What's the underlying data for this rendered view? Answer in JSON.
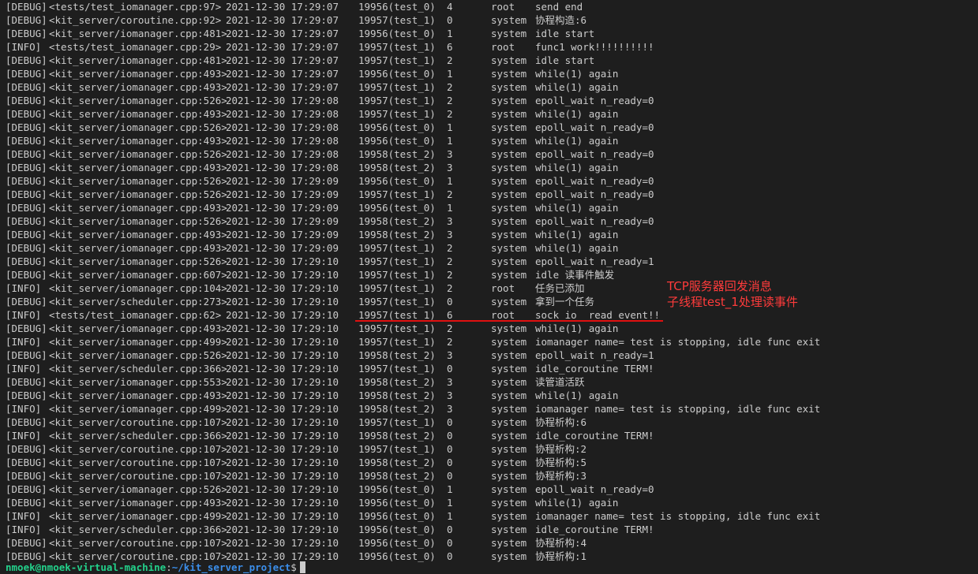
{
  "terminal": {
    "rows": [
      {
        "level": "[DEBUG]",
        "source": "<tests/test_iomanager.cpp:97>",
        "time": "2021-12-30 17:29:07",
        "thread": "19956(test_0)",
        "fiber": "4",
        "logger": "root",
        "message": "send end"
      },
      {
        "level": "[DEBUG]",
        "source": "<kit_server/coroutine.cpp:92>",
        "time": "2021-12-30 17:29:07",
        "thread": "19957(test_1)",
        "fiber": "0",
        "logger": "system",
        "message": "协程构造:6"
      },
      {
        "level": "[DEBUG]",
        "source": "<kit_server/iomanager.cpp:481>",
        "time": "2021-12-30 17:29:07",
        "thread": "19956(test_0)",
        "fiber": "1",
        "logger": "system",
        "message": "idle start"
      },
      {
        "level": "[INFO]",
        "source": "<tests/test_iomanager.cpp:29>",
        "time": "2021-12-30 17:29:07",
        "thread": "19957(test_1)",
        "fiber": "6",
        "logger": "root",
        "message": "func1 work!!!!!!!!!!"
      },
      {
        "level": "[DEBUG]",
        "source": "<kit_server/iomanager.cpp:481>",
        "time": "2021-12-30 17:29:07",
        "thread": "19957(test_1)",
        "fiber": "2",
        "logger": "system",
        "message": "idle start"
      },
      {
        "level": "[DEBUG]",
        "source": "<kit_server/iomanager.cpp:493>",
        "time": "2021-12-30 17:29:07",
        "thread": "19956(test_0)",
        "fiber": "1",
        "logger": "system",
        "message": "while(1) again"
      },
      {
        "level": "[DEBUG]",
        "source": "<kit_server/iomanager.cpp:493>",
        "time": "2021-12-30 17:29:07",
        "thread": "19957(test_1)",
        "fiber": "2",
        "logger": "system",
        "message": "while(1) again"
      },
      {
        "level": "[DEBUG]",
        "source": "<kit_server/iomanager.cpp:526>",
        "time": "2021-12-30 17:29:08",
        "thread": "19957(test_1)",
        "fiber": "2",
        "logger": "system",
        "message": "epoll_wait n_ready=0"
      },
      {
        "level": "[DEBUG]",
        "source": "<kit_server/iomanager.cpp:493>",
        "time": "2021-12-30 17:29:08",
        "thread": "19957(test_1)",
        "fiber": "2",
        "logger": "system",
        "message": "while(1) again"
      },
      {
        "level": "[DEBUG]",
        "source": "<kit_server/iomanager.cpp:526>",
        "time": "2021-12-30 17:29:08",
        "thread": "19956(test_0)",
        "fiber": "1",
        "logger": "system",
        "message": "epoll_wait n_ready=0"
      },
      {
        "level": "[DEBUG]",
        "source": "<kit_server/iomanager.cpp:493>",
        "time": "2021-12-30 17:29:08",
        "thread": "19956(test_0)",
        "fiber": "1",
        "logger": "system",
        "message": "while(1) again"
      },
      {
        "level": "[DEBUG]",
        "source": "<kit_server/iomanager.cpp:526>",
        "time": "2021-12-30 17:29:08",
        "thread": "19958(test_2)",
        "fiber": "3",
        "logger": "system",
        "message": "epoll_wait n_ready=0"
      },
      {
        "level": "[DEBUG]",
        "source": "<kit_server/iomanager.cpp:493>",
        "time": "2021-12-30 17:29:08",
        "thread": "19958(test_2)",
        "fiber": "3",
        "logger": "system",
        "message": "while(1) again"
      },
      {
        "level": "[DEBUG]",
        "source": "<kit_server/iomanager.cpp:526>",
        "time": "2021-12-30 17:29:09",
        "thread": "19956(test_0)",
        "fiber": "1",
        "logger": "system",
        "message": "epoll_wait n_ready=0"
      },
      {
        "level": "[DEBUG]",
        "source": "<kit_server/iomanager.cpp:526>",
        "time": "2021-12-30 17:29:09",
        "thread": "19957(test_1)",
        "fiber": "2",
        "logger": "system",
        "message": "epoll_wait n_ready=0"
      },
      {
        "level": "[DEBUG]",
        "source": "<kit_server/iomanager.cpp:493>",
        "time": "2021-12-30 17:29:09",
        "thread": "19956(test_0)",
        "fiber": "1",
        "logger": "system",
        "message": "while(1) again"
      },
      {
        "level": "[DEBUG]",
        "source": "<kit_server/iomanager.cpp:526>",
        "time": "2021-12-30 17:29:09",
        "thread": "19958(test_2)",
        "fiber": "3",
        "logger": "system",
        "message": "epoll_wait n_ready=0"
      },
      {
        "level": "[DEBUG]",
        "source": "<kit_server/iomanager.cpp:493>",
        "time": "2021-12-30 17:29:09",
        "thread": "19958(test_2)",
        "fiber": "3",
        "logger": "system",
        "message": "while(1) again"
      },
      {
        "level": "[DEBUG]",
        "source": "<kit_server/iomanager.cpp:493>",
        "time": "2021-12-30 17:29:09",
        "thread": "19957(test_1)",
        "fiber": "2",
        "logger": "system",
        "message": "while(1) again"
      },
      {
        "level": "[DEBUG]",
        "source": "<kit_server/iomanager.cpp:526>",
        "time": "2021-12-30 17:29:10",
        "thread": "19957(test_1)",
        "fiber": "2",
        "logger": "system",
        "message": "epoll_wait n_ready=1"
      },
      {
        "level": "[DEBUG]",
        "source": "<kit_server/iomanager.cpp:607>",
        "time": "2021-12-30 17:29:10",
        "thread": "19957(test_1)",
        "fiber": "2",
        "logger": "system",
        "message": "idle 读事件触发"
      },
      {
        "level": "[INFO]",
        "source": "<kit_server/iomanager.cpp:104>",
        "time": "2021-12-30 17:29:10",
        "thread": "19957(test_1)",
        "fiber": "2",
        "logger": "root",
        "message": "任务已添加"
      },
      {
        "level": "[DEBUG]",
        "source": "<kit_server/scheduler.cpp:273>",
        "time": "2021-12-30 17:29:10",
        "thread": "19957(test_1)",
        "fiber": "0",
        "logger": "system",
        "message": "拿到一个任务"
      },
      {
        "level": "[INFO]",
        "source": "<tests/test_iomanager.cpp:62>",
        "time": "2021-12-30 17:29:10",
        "thread": "19957(test_1)",
        "fiber": "6",
        "logger": "root",
        "message": "sock_io  read event!!"
      },
      {
        "level": "[DEBUG]",
        "source": "<kit_server/iomanager.cpp:493>",
        "time": "2021-12-30 17:29:10",
        "thread": "19957(test_1)",
        "fiber": "2",
        "logger": "system",
        "message": "while(1) again"
      },
      {
        "level": "[INFO]",
        "source": "<kit_server/iomanager.cpp:499>",
        "time": "2021-12-30 17:29:10",
        "thread": "19957(test_1)",
        "fiber": "2",
        "logger": "system",
        "message": "iomanager name= test is stopping, idle func exit"
      },
      {
        "level": "[DEBUG]",
        "source": "<kit_server/iomanager.cpp:526>",
        "time": "2021-12-30 17:29:10",
        "thread": "19958(test_2)",
        "fiber": "3",
        "logger": "system",
        "message": "epoll_wait n_ready=1"
      },
      {
        "level": "[INFO]",
        "source": "<kit_server/scheduler.cpp:366>",
        "time": "2021-12-30 17:29:10",
        "thread": "19957(test_1)",
        "fiber": "0",
        "logger": "system",
        "message": "idle_coroutine TERM!"
      },
      {
        "level": "[DEBUG]",
        "source": "<kit_server/iomanager.cpp:553>",
        "time": "2021-12-30 17:29:10",
        "thread": "19958(test_2)",
        "fiber": "3",
        "logger": "system",
        "message": "读管道活跃"
      },
      {
        "level": "[DEBUG]",
        "source": "<kit_server/iomanager.cpp:493>",
        "time": "2021-12-30 17:29:10",
        "thread": "19958(test_2)",
        "fiber": "3",
        "logger": "system",
        "message": "while(1) again"
      },
      {
        "level": "[INFO]",
        "source": "<kit_server/iomanager.cpp:499>",
        "time": "2021-12-30 17:29:10",
        "thread": "19958(test_2)",
        "fiber": "3",
        "logger": "system",
        "message": "iomanager name= test is stopping, idle func exit"
      },
      {
        "level": "[DEBUG]",
        "source": "<kit_server/coroutine.cpp:107>",
        "time": "2021-12-30 17:29:10",
        "thread": "19957(test_1)",
        "fiber": "0",
        "logger": "system",
        "message": "协程析构:6"
      },
      {
        "level": "[INFO]",
        "source": "<kit_server/scheduler.cpp:366>",
        "time": "2021-12-30 17:29:10",
        "thread": "19958(test_2)",
        "fiber": "0",
        "logger": "system",
        "message": "idle_coroutine TERM!"
      },
      {
        "level": "[DEBUG]",
        "source": "<kit_server/coroutine.cpp:107>",
        "time": "2021-12-30 17:29:10",
        "thread": "19957(test_1)",
        "fiber": "0",
        "logger": "system",
        "message": "协程析构:2"
      },
      {
        "level": "[DEBUG]",
        "source": "<kit_server/coroutine.cpp:107>",
        "time": "2021-12-30 17:29:10",
        "thread": "19958(test_2)",
        "fiber": "0",
        "logger": "system",
        "message": "协程析构:5"
      },
      {
        "level": "[DEBUG]",
        "source": "<kit_server/coroutine.cpp:107>",
        "time": "2021-12-30 17:29:10",
        "thread": "19958(test_2)",
        "fiber": "0",
        "logger": "system",
        "message": "协程析构:3"
      },
      {
        "level": "[DEBUG]",
        "source": "<kit_server/iomanager.cpp:526>",
        "time": "2021-12-30 17:29:10",
        "thread": "19956(test_0)",
        "fiber": "1",
        "logger": "system",
        "message": "epoll_wait n_ready=0"
      },
      {
        "level": "[DEBUG]",
        "source": "<kit_server/iomanager.cpp:493>",
        "time": "2021-12-30 17:29:10",
        "thread": "19956(test_0)",
        "fiber": "1",
        "logger": "system",
        "message": "while(1) again"
      },
      {
        "level": "[INFO]",
        "source": "<kit_server/iomanager.cpp:499>",
        "time": "2021-12-30 17:29:10",
        "thread": "19956(test_0)",
        "fiber": "1",
        "logger": "system",
        "message": "iomanager name= test is stopping, idle func exit"
      },
      {
        "level": "[INFO]",
        "source": "<kit_server/scheduler.cpp:366>",
        "time": "2021-12-30 17:29:10",
        "thread": "19956(test_0)",
        "fiber": "0",
        "logger": "system",
        "message": "idle_coroutine TERM!"
      },
      {
        "level": "[DEBUG]",
        "source": "<kit_server/coroutine.cpp:107>",
        "time": "2021-12-30 17:29:10",
        "thread": "19956(test_0)",
        "fiber": "0",
        "logger": "system",
        "message": "协程析构:4"
      },
      {
        "level": "[DEBUG]",
        "source": "<kit_server/coroutine.cpp:107>",
        "time": "2021-12-30 17:29:10",
        "thread": "19956(test_0)",
        "fiber": "0",
        "logger": "system",
        "message": "协程析构:1"
      }
    ]
  },
  "prompt": {
    "user_host": "nmoek@nmoek-virtual-machine",
    "separator": ":",
    "path": "~/kit_server_project",
    "symbol": "$"
  },
  "annotation": {
    "line1": "TCP服务器回发消息",
    "line2": "子线程test_1处理读事件",
    "color": "#ff3b3b"
  }
}
